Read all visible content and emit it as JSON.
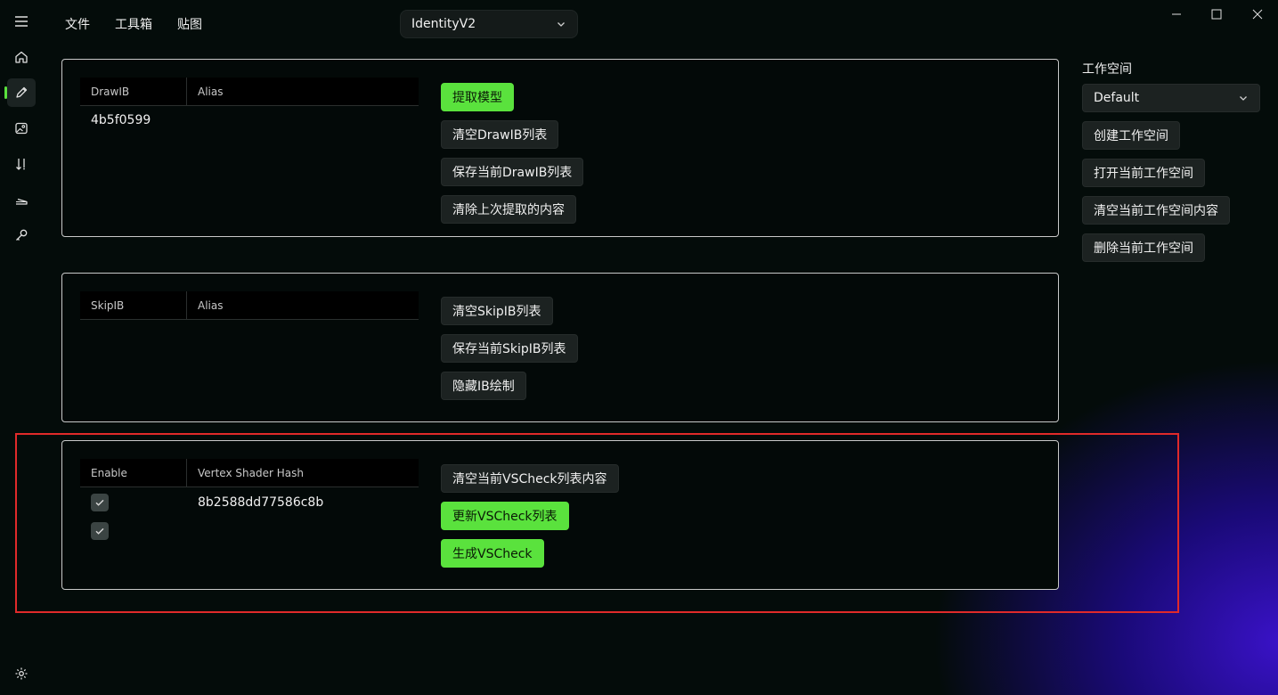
{
  "menu": {
    "items": [
      "文件",
      "工具箱",
      "贴图"
    ]
  },
  "game_select": {
    "value": "IdentityV2"
  },
  "nav": {
    "items": [
      "home-icon",
      "edit-icon",
      "image-icon",
      "sort-icon",
      "scanner-icon",
      "key-icon"
    ],
    "settings": "settings-icon"
  },
  "drawib_panel": {
    "col1": "DrawIB",
    "col2": "Alias",
    "rows": [
      {
        "drawib": "4b5f0599",
        "alias": ""
      }
    ],
    "buttons": [
      "提取模型",
      "清空DrawIB列表",
      "保存当前DrawIB列表",
      "清除上次提取的内容"
    ]
  },
  "skipib_panel": {
    "col1": "SkipIB",
    "col2": "Alias",
    "buttons": [
      "清空SkipIB列表",
      "保存当前SkipIB列表",
      "隐藏IB绘制"
    ]
  },
  "vscheck_panel": {
    "col1": "Enable",
    "col2": "Vertex Shader Hash",
    "rows": [
      {
        "enabled": true,
        "hash": "8b2588dd77586c8b"
      },
      {
        "enabled": true,
        "hash": ""
      }
    ],
    "buttons": [
      "清空当前VSCheck列表内容",
      "更新VSCheck列表",
      "生成VSCheck"
    ]
  },
  "workspace": {
    "label": "工作空间",
    "selected": "Default",
    "buttons": [
      "创建工作空间",
      "打开当前工作空间",
      "清空当前工作空间内容",
      "删除当前工作空间"
    ]
  },
  "colors": {
    "accent": "#5ae23d",
    "highlight": "#e02a2a",
    "background": "#040c0a"
  }
}
